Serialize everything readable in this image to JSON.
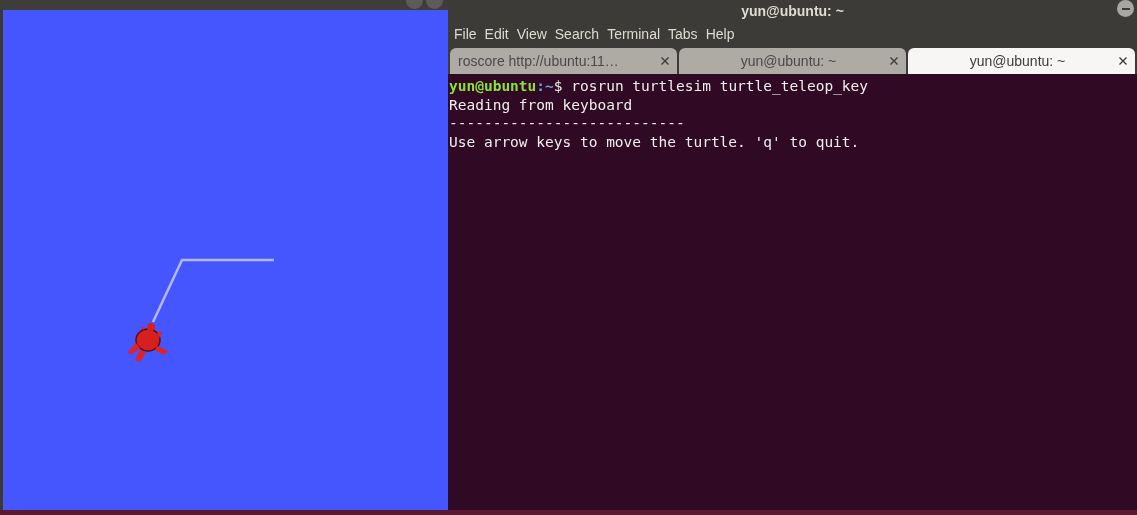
{
  "terminal": {
    "title": "yun@ubuntu: ~",
    "menu": [
      "File",
      "Edit",
      "View",
      "Search",
      "Terminal",
      "Tabs",
      "Help"
    ],
    "tabs": [
      {
        "label": "roscore http://ubuntu:11…",
        "selected": false
      },
      {
        "label": "yun@ubuntu: ~",
        "selected": false
      },
      {
        "label": "yun@ubuntu: ~",
        "selected": true
      }
    ],
    "lines": [
      {
        "kind": "prompt",
        "prompt": "yun@ubuntu",
        "path": ":~",
        "text": "$ rosrun turtlesim turtle_teleop_key"
      },
      {
        "kind": "output",
        "text": "Reading from keyboard"
      },
      {
        "kind": "output",
        "text": "---------------------------"
      },
      {
        "kind": "output",
        "text": "Use arrow keys to move the turtle. 'q' to quit."
      }
    ]
  }
}
